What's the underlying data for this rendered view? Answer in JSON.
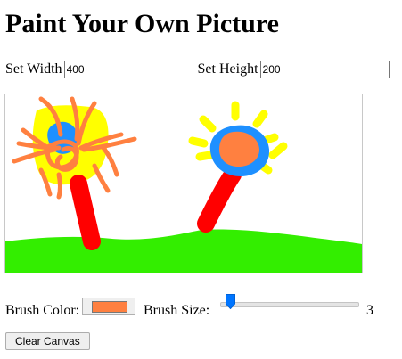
{
  "page": {
    "title": "Paint Your Own Picture"
  },
  "dimensions": {
    "width_label": "Set Width",
    "width_value": "400",
    "height_label": "Set Height",
    "height_value": "200"
  },
  "controls": {
    "brush_color_label": "Brush Color:",
    "brush_color": "#ff8040",
    "brush_size_label": "Brush Size:",
    "brush_size_value": "3",
    "brush_size_min": 1,
    "brush_size_max": 50,
    "clear_label": "Clear Canvas"
  },
  "drawing_colors": {
    "grass": "#33ee00",
    "trunk": "#ff0000",
    "blue": "#1e90ff",
    "yellow": "#ffff00",
    "orange": "#ff8040"
  }
}
